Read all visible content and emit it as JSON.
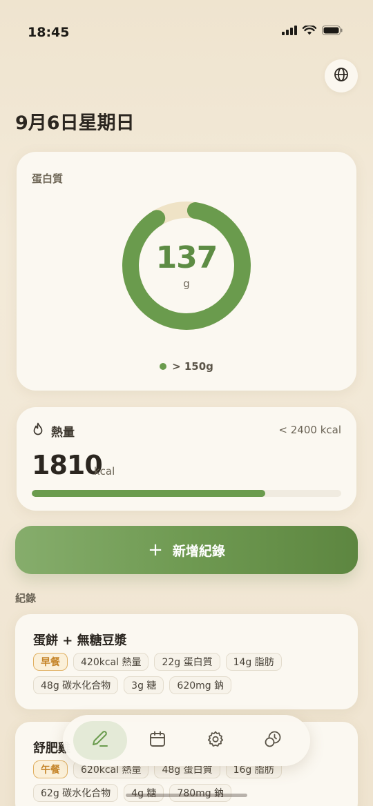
{
  "status_bar": {
    "time": "18:45",
    "icons": [
      "signal-icon",
      "wifi-icon",
      "battery-icon"
    ]
  },
  "header": {
    "date_title": "9月6日星期日",
    "language_icon": "globe-icon"
  },
  "protein": {
    "label": "蛋白質",
    "value": "137",
    "unit": "g",
    "goal": "> 150g",
    "progress_fraction": 0.913
  },
  "calories": {
    "label": "熱量",
    "icon": "flame-icon",
    "goal": "< 2400 kcal",
    "value": "1810",
    "unit": "kcal",
    "progress_fraction": 0.754
  },
  "add_button": {
    "label": "新增紀錄",
    "icon": "plus-icon"
  },
  "records": {
    "section_label": "紀錄",
    "items": [
      {
        "title": "蛋餅 + 無糖豆漿",
        "meal": "早餐",
        "tags": [
          "420kcal 熱量",
          "22g 蛋白質",
          "14g 脂肪",
          "48g 碳水化合物",
          "3g 糖",
          "620mg 鈉"
        ]
      },
      {
        "title": "舒肥雞",
        "meal": "午餐",
        "tags": [
          "620kcal 熱量",
          "48g 蛋白質",
          "16g 脂肪",
          "62g 碳水化合物",
          "4g 糖",
          "780mg 鈉"
        ]
      }
    ]
  },
  "bottom_nav": {
    "items": [
      "edit-icon",
      "calendar-icon",
      "settings-icon",
      "history-icon"
    ],
    "active": "edit-icon"
  },
  "colors": {
    "accent_green": "#6a9b4d",
    "meal_tag": "#c5852a",
    "background": "#f2e8d6"
  }
}
